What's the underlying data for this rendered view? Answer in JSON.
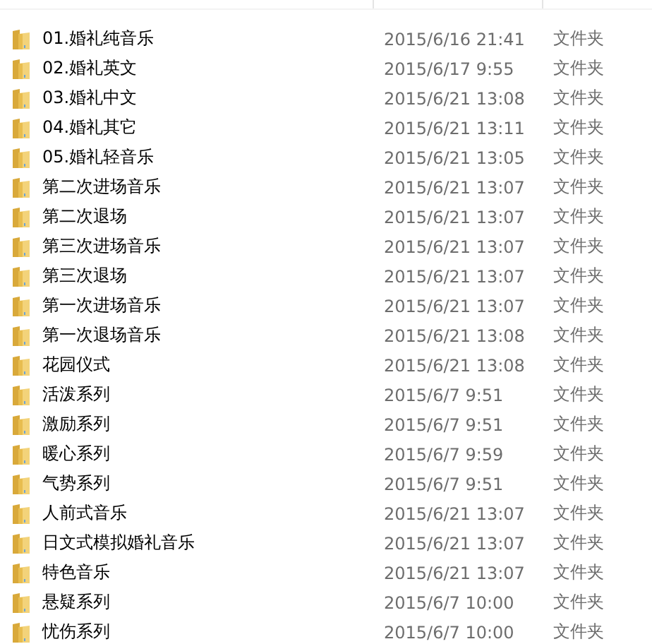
{
  "rows": [
    {
      "name": "01.婚礼纯音乐",
      "modified": "2015/6/16 21:41",
      "type": "文件夹"
    },
    {
      "name": "02.婚礼英文",
      "modified": "2015/6/17 9:55",
      "type": "文件夹"
    },
    {
      "name": "03.婚礼中文",
      "modified": "2015/6/21 13:08",
      "type": "文件夹"
    },
    {
      "name": "04.婚礼其它",
      "modified": "2015/6/21 13:11",
      "type": "文件夹"
    },
    {
      "name": "05.婚礼轻音乐",
      "modified": "2015/6/21 13:05",
      "type": "文件夹"
    },
    {
      "name": "第二次进场音乐",
      "modified": "2015/6/21 13:07",
      "type": "文件夹"
    },
    {
      "name": "第二次退场",
      "modified": "2015/6/21 13:07",
      "type": "文件夹"
    },
    {
      "name": "第三次进场音乐",
      "modified": "2015/6/21 13:07",
      "type": "文件夹"
    },
    {
      "name": "第三次退场",
      "modified": "2015/6/21 13:07",
      "type": "文件夹"
    },
    {
      "name": "第一次进场音乐",
      "modified": "2015/6/21 13:07",
      "type": "文件夹"
    },
    {
      "name": "第一次退场音乐",
      "modified": "2015/6/21 13:08",
      "type": "文件夹"
    },
    {
      "name": "花园仪式",
      "modified": "2015/6/21 13:08",
      "type": "文件夹"
    },
    {
      "name": "活泼系列",
      "modified": "2015/6/7 9:51",
      "type": "文件夹"
    },
    {
      "name": "激励系列",
      "modified": "2015/6/7 9:51",
      "type": "文件夹"
    },
    {
      "name": "暖心系列",
      "modified": "2015/6/7 9:59",
      "type": "文件夹"
    },
    {
      "name": "气势系列",
      "modified": "2015/6/7 9:51",
      "type": "文件夹"
    },
    {
      "name": "人前式音乐",
      "modified": "2015/6/21 13:07",
      "type": "文件夹"
    },
    {
      "name": "日文式模拟婚礼音乐",
      "modified": "2015/6/21 13:07",
      "type": "文件夹"
    },
    {
      "name": "特色音乐",
      "modified": "2015/6/21 13:07",
      "type": "文件夹"
    },
    {
      "name": "悬疑系列",
      "modified": "2015/6/7 10:00",
      "type": "文件夹"
    },
    {
      "name": "忧伤系列",
      "modified": "2015/6/7 10:00",
      "type": "文件夹"
    }
  ]
}
